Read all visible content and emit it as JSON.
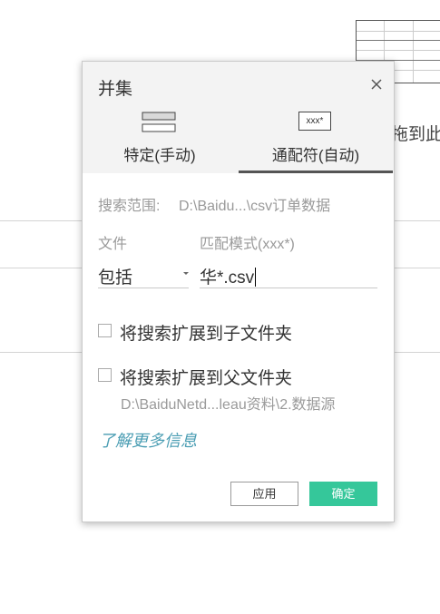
{
  "background": {
    "partial_text": "拖到此"
  },
  "dialog": {
    "title": "并集",
    "close_icon": "close-icon",
    "tabs": [
      {
        "label": "特定(手动)",
        "icon": "manual-list-icon",
        "selected": false
      },
      {
        "label": "通配符(自动)",
        "icon_text": "xxx*",
        "icon": "wildcard-icon",
        "selected": true
      }
    ],
    "search_scope": {
      "label": "搜索范围:",
      "value": "D:\\Baidu...\\csv订单数据"
    },
    "file": {
      "label": "文件",
      "selected": "包括"
    },
    "match_pattern": {
      "label": "匹配模式(xxx*)",
      "value": "华*.csv"
    },
    "checkboxes": [
      {
        "label": "将搜索扩展到子文件夹",
        "checked": false
      },
      {
        "label": "将搜索扩展到父文件夹",
        "checked": false,
        "subtext": "D:\\BaiduNetd...leau资料\\2.数据源"
      }
    ],
    "learn_more": "了解更多信息",
    "buttons": {
      "apply": "应用",
      "ok": "确定"
    },
    "colors": {
      "accent_green": "#35c79a",
      "link_blue": "#4a9db3",
      "header_bg": "#f3f3f3"
    }
  }
}
